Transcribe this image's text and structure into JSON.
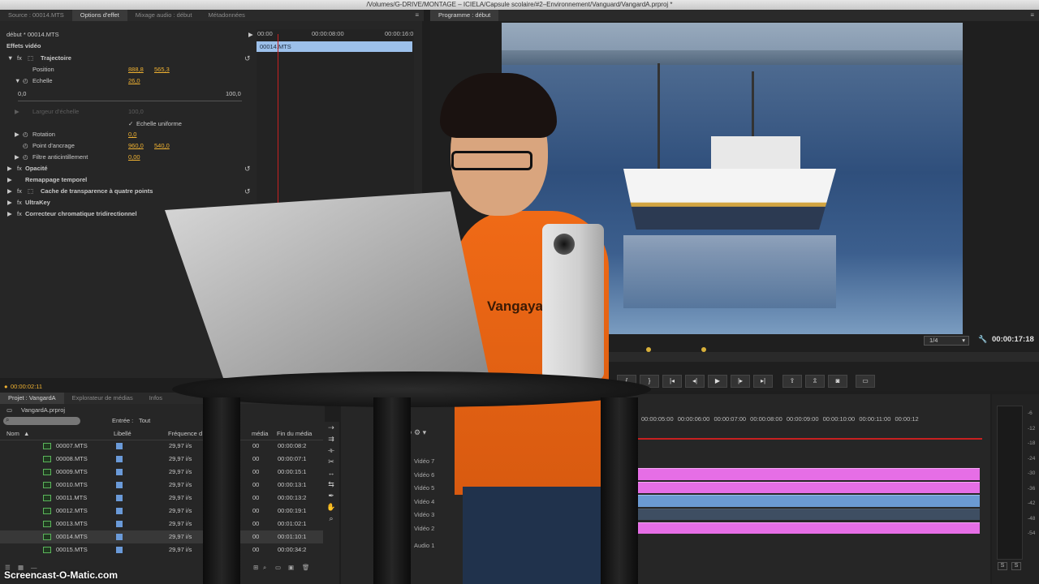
{
  "window": {
    "title": "/Volumes/G-DRIVE/MONTAGE – ICIELA/Capsule scolaire/#2–Environnement/Vanguard/VangardA.prproj *"
  },
  "source_panel": {
    "tabs": [
      "Source : 00014.MTS",
      "Options d'effet",
      "Mixage audio : début",
      "Métadonnées"
    ],
    "sequence_clip": "début * 00014.MTS",
    "section": "Effets vidéo",
    "timecodes": [
      "00:00",
      "00:00:08:00",
      "00:00:16:0"
    ],
    "clip_label": "00014.MTS",
    "current_time": "00:00:02:11"
  },
  "effects": {
    "trajectoire": "Trajectoire",
    "position_label": "Position",
    "position_x": "888,8",
    "position_y": "565,3",
    "echelle_label": "Echelle",
    "echelle_val": "26,0",
    "slider_min": "0,0",
    "slider_max": "100,0",
    "largeur_label": "Largeur d'échelle",
    "largeur_val": "100,0",
    "uniforme": "Echelle uniforme",
    "rotation_label": "Rotation",
    "rotation_val": "0,0",
    "ancrage_label": "Point d'ancrage",
    "ancrage_x": "960,0",
    "ancrage_y": "540,0",
    "filtre_label": "Filtre anticintillement",
    "filtre_val": "0,00",
    "opacite": "Opacité",
    "remappage": "Remappage temporel",
    "cache": "Cache de transparence à quatre points",
    "ultrakey": "UltraKey",
    "correcteur": "Correcteur chromatique tridirectionnel"
  },
  "program": {
    "tab": "Programme : début",
    "zoom": "1/4",
    "timecode": "00:00:17:18"
  },
  "project": {
    "tabs": [
      "Projet : VangardA",
      "Explorateur de médias",
      "Infos"
    ],
    "file": "VangardA.prproj",
    "entry_label": "Entrée :",
    "entry_value": "Tout",
    "col_nom": "Nom",
    "col_libelle": "Libellé",
    "col_freq": "Fréquence d",
    "col_debut": "média",
    "col_fin": "Fin du média",
    "rows": [
      {
        "name": "00007.MTS",
        "fps": "29,97 i/s",
        "start": "00",
        "end": "00:00:08:2"
      },
      {
        "name": "00008.MTS",
        "fps": "29,97 i/s",
        "start": "00",
        "end": "00:00:07:1"
      },
      {
        "name": "00009.MTS",
        "fps": "29,97 i/s",
        "start": "00",
        "end": "00:00:15:1"
      },
      {
        "name": "00010.MTS",
        "fps": "29,97 i/s",
        "start": "00",
        "end": "00:00:13:1"
      },
      {
        "name": "00011.MTS",
        "fps": "29,97 i/s",
        "start": "00",
        "end": "00:00:13:2"
      },
      {
        "name": "00012.MTS",
        "fps": "29,97 i/s",
        "start": "00",
        "end": "00:00:19:1"
      },
      {
        "name": "00013.MTS",
        "fps": "29,97 i/s",
        "start": "00",
        "end": "00:01:02:1"
      },
      {
        "name": "00014.MTS",
        "fps": "29,97 i/s",
        "start": "00",
        "end": "00:01:10:1"
      },
      {
        "name": "00015.MTS",
        "fps": "29,97 i/s",
        "start": "00",
        "end": "00:00:34:2"
      }
    ]
  },
  "timeline": {
    "ruler": [
      "00:00:05:00",
      "00:00:06:00",
      "00:00:07:00",
      "00:00:08:00",
      "00:00:09:00",
      "00:00:10:00",
      "00:00:11:00",
      "00:00:12"
    ],
    "tracks": [
      "Vidéo 7",
      "Vidéo 6",
      "Vidéo 5",
      "Vidéo 4",
      "Vidéo 3",
      "Vidéo 2",
      "Audio 1"
    ]
  },
  "meters": {
    "scale": [
      "-6",
      "-12",
      "-18",
      "-24",
      "-30",
      "-36",
      "-42",
      "-48",
      "-54"
    ],
    "solo": [
      "S",
      "S"
    ]
  },
  "scene": {
    "shirt_text": "VangayaV",
    "watermark": "Screencast-O-Matic.com"
  },
  "colors": {
    "accent_value": "#f0b232",
    "clip_blue": "#6b9ad2",
    "clip_pink": "#e66ee6",
    "playhead": "#c82020"
  }
}
